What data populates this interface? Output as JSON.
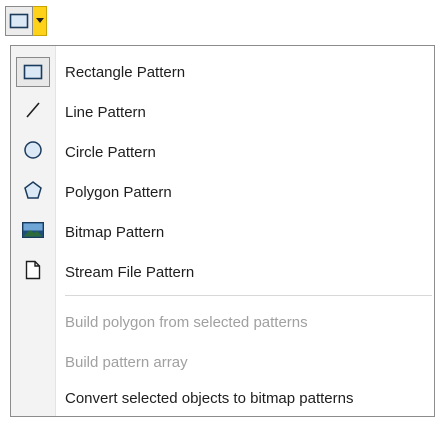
{
  "toolbar": {
    "pattern_button_icon": "rectangle-icon",
    "dropdown_icon": "caret-down-icon",
    "accent": "#ffd21a"
  },
  "menu": {
    "pattern_items": [
      {
        "label": "Rectangle Pattern",
        "icon": "rectangle-icon",
        "selected": true
      },
      {
        "label": "Line Pattern",
        "icon": "line-icon"
      },
      {
        "label": "Circle Pattern",
        "icon": "circle-icon"
      },
      {
        "label": "Polygon Pattern",
        "icon": "polygon-icon"
      },
      {
        "label": "Bitmap Pattern",
        "icon": "bitmap-icon"
      },
      {
        "label": "Stream File Pattern",
        "icon": "document-icon"
      }
    ],
    "action_items": [
      {
        "label": "Build polygon from selected patterns",
        "enabled": false
      },
      {
        "label": "Build pattern array",
        "enabled": false
      },
      {
        "label": "Convert selected objects to bitmap patterns",
        "enabled": true
      }
    ]
  }
}
